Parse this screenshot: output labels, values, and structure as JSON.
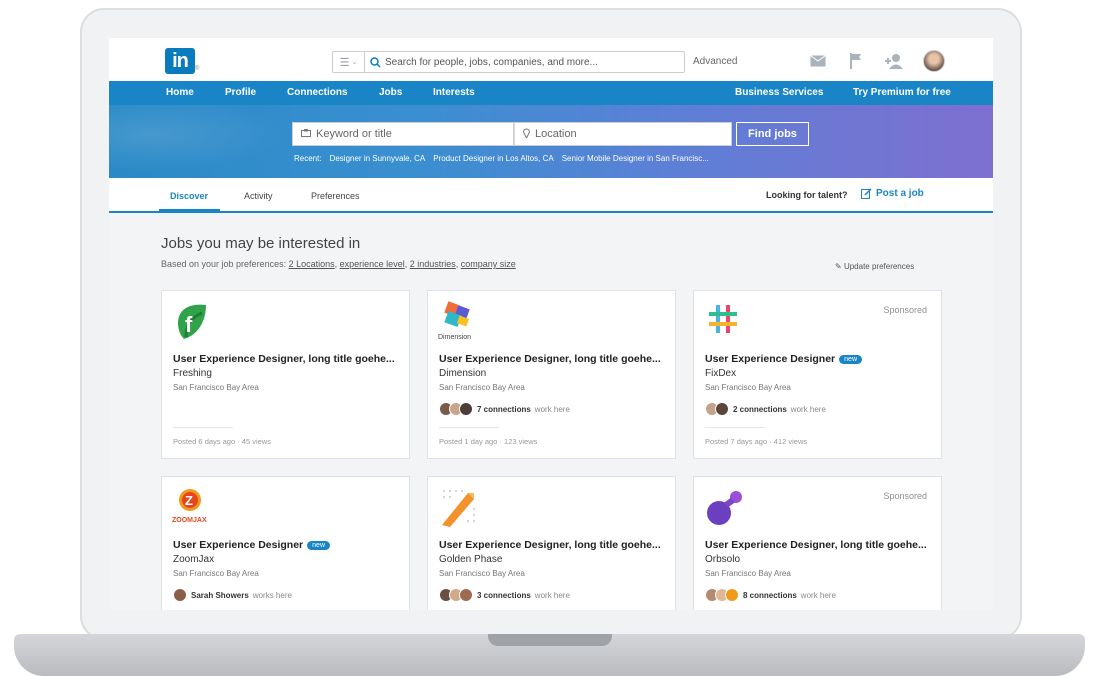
{
  "topbar": {
    "logo": "in",
    "search_placeholder": "Search for people, jobs, companies, and more...",
    "advanced": "Advanced"
  },
  "nav": {
    "items": [
      "Home",
      "Profile",
      "Connections",
      "Jobs",
      "Interests"
    ],
    "business": "Business Services",
    "premium": "Try Premium for free"
  },
  "hero": {
    "keyword_placeholder": "Keyword or title",
    "location_placeholder": "Location",
    "find_button": "Find jobs",
    "recent_label": "Recent:",
    "recent_items": [
      "Designer in Sunnyvale, CA",
      "Product Designer in Los Altos, CA",
      "Senior Mobile Designer in San Francisc..."
    ]
  },
  "tabs": {
    "items": [
      "Discover",
      "Activity",
      "Preferences"
    ],
    "active": "Discover",
    "looking": "Looking for talent?",
    "post_job": "Post a job"
  },
  "section": {
    "title": "Jobs you may be interested in",
    "sub_prefix": "Based on your job preferences:",
    "links": [
      "2 Locations",
      "experience level",
      "2 industries",
      "company size"
    ],
    "update": "Update preferences"
  },
  "jobs": [
    {
      "title": "User Experience Designer, long title goehe...",
      "company": "Freshing",
      "location": "San Francisco Bay Area",
      "sponsored": "",
      "new": "",
      "connections_count": "",
      "connections_suffix": "",
      "posted": "Posted 6 days ago · 45 views",
      "logo": "freshing-logo"
    },
    {
      "title": "User Experience Designer, long title goehe...",
      "company": "Dimension",
      "location": "San Francisco Bay Area",
      "sponsored": "",
      "new": "",
      "connections_count": "7 connections",
      "connections_suffix": "work here",
      "posted": "Posted 1 day ago · 123 views",
      "logo": "dimension-logo"
    },
    {
      "title": "User Experience Designer",
      "company": "FixDex",
      "location": "San Francisco Bay Area",
      "sponsored": "Sponsored",
      "new": "new",
      "connections_count": "2 connections",
      "connections_suffix": "work here",
      "posted": "Posted 7 days ago · 412 views",
      "logo": "fixdex-logo"
    },
    {
      "title": "User Experience Designer",
      "company": "ZoomJax",
      "location": "San Francisco Bay Area",
      "sponsored": "",
      "new": "new",
      "connections_count": "Sarah Showers",
      "connections_suffix": "works here",
      "posted": "",
      "logo": "zoomjax-logo"
    },
    {
      "title": "User Experience Designer, long title goehe...",
      "company": "Golden Phase",
      "location": "San Francisco Bay Area",
      "sponsored": "",
      "new": "",
      "connections_count": "3 connections",
      "connections_suffix": "work here",
      "posted": "",
      "logo": "golden-phase-logo"
    },
    {
      "title": "User Experience Designer, long title goehe...",
      "company": "Orbsolo",
      "location": "San Francisco Bay Area",
      "sponsored": "Sponsored",
      "new": "",
      "connections_count": "8 connections",
      "connections_suffix": "work here",
      "posted": "",
      "logo": "orbsolo-logo"
    }
  ],
  "logo_text": {
    "dimension": "Dimension",
    "zoomjax": "ZOOMJAX"
  },
  "colors": {
    "brand_blue": "#1a85c6",
    "hero_end": "#7e6fd0"
  }
}
